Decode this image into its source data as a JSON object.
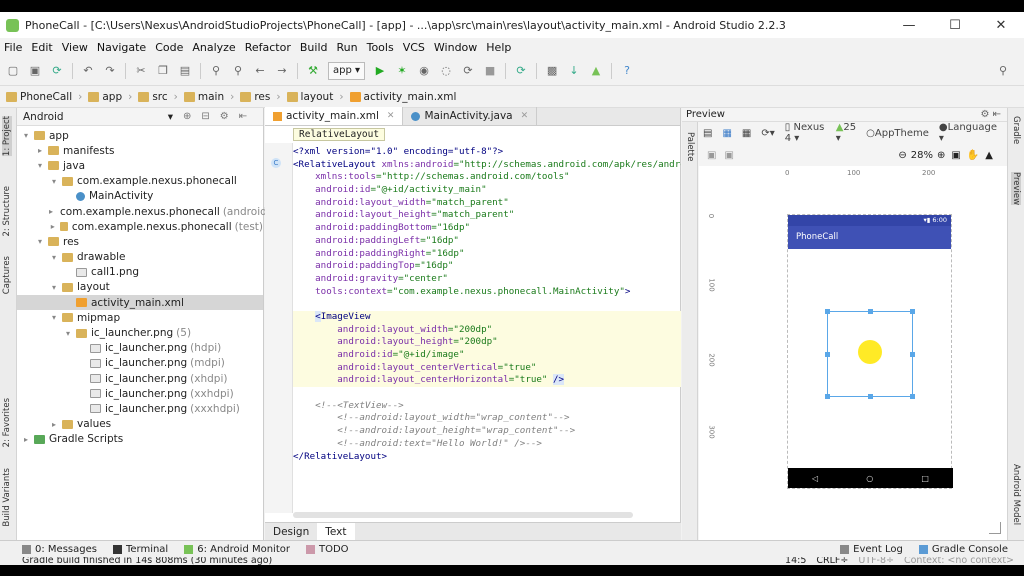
{
  "window": {
    "title": "PhoneCall - [C:\\Users\\Nexus\\AndroidStudioProjects\\PhoneCall] - [app] - ...\\app\\src\\main\\res\\layout\\activity_main.xml - Android Studio 2.2.3",
    "minimize": "—",
    "maximize": "☐",
    "close": "✕"
  },
  "menu": [
    "File",
    "Edit",
    "View",
    "Navigate",
    "Code",
    "Analyze",
    "Refactor",
    "Build",
    "Run",
    "Tools",
    "VCS",
    "Window",
    "Help"
  ],
  "toolbar": {
    "run_config": "app ▾"
  },
  "breadcrumbs": [
    "PhoneCall",
    "app",
    "src",
    "main",
    "res",
    "layout",
    "activity_main.xml"
  ],
  "left_strip": {
    "project": "1: Project",
    "structure": "2: Structure",
    "captures": "Captures",
    "favorites": "2: Favorites",
    "build_variants": "Build Variants"
  },
  "right_strip": {
    "gradle": "Gradle",
    "preview": "Preview",
    "android_model": "Android Model"
  },
  "project": {
    "view_selector": "Android",
    "tree": [
      {
        "label": "app",
        "level": 0,
        "icon": "folder",
        "twisty": "▾"
      },
      {
        "label": "manifests",
        "level": 1,
        "icon": "folder",
        "twisty": "▸"
      },
      {
        "label": "java",
        "level": 1,
        "icon": "folder",
        "twisty": "▾"
      },
      {
        "label": "com.example.nexus.phonecall",
        "level": 2,
        "icon": "folder",
        "twisty": "▾"
      },
      {
        "label": "MainActivity",
        "level": 3,
        "icon": "cls",
        "twisty": ""
      },
      {
        "label": "com.example.nexus.phonecall",
        "suffix": "(androidTest)",
        "level": 2,
        "icon": "folder",
        "twisty": "▸"
      },
      {
        "label": "com.example.nexus.phonecall",
        "suffix": "(test)",
        "level": 2,
        "icon": "folder",
        "twisty": "▸"
      },
      {
        "label": "res",
        "level": 1,
        "icon": "folder",
        "twisty": "▾"
      },
      {
        "label": "drawable",
        "level": 2,
        "icon": "folder",
        "twisty": "▾"
      },
      {
        "label": "call1.png",
        "level": 3,
        "icon": "png",
        "twisty": ""
      },
      {
        "label": "layout",
        "level": 2,
        "icon": "folder",
        "twisty": "▾"
      },
      {
        "label": "activity_main.xml",
        "level": 3,
        "icon": "xml",
        "twisty": "",
        "selected": true
      },
      {
        "label": "mipmap",
        "level": 2,
        "icon": "folder",
        "twisty": "▾"
      },
      {
        "label": "ic_launcher.png",
        "suffix": "(5)",
        "level": 3,
        "icon": "folder",
        "twisty": "▾"
      },
      {
        "label": "ic_launcher.png",
        "suffix": "(hdpi)",
        "level": 4,
        "icon": "png",
        "twisty": ""
      },
      {
        "label": "ic_launcher.png",
        "suffix": "(mdpi)",
        "level": 4,
        "icon": "png",
        "twisty": ""
      },
      {
        "label": "ic_launcher.png",
        "suffix": "(xhdpi)",
        "level": 4,
        "icon": "png",
        "twisty": ""
      },
      {
        "label": "ic_launcher.png",
        "suffix": "(xxhdpi)",
        "level": 4,
        "icon": "png",
        "twisty": ""
      },
      {
        "label": "ic_launcher.png",
        "suffix": "(xxxhdpi)",
        "level": 4,
        "icon": "png",
        "twisty": ""
      },
      {
        "label": "values",
        "level": 2,
        "icon": "folder",
        "twisty": "▸"
      },
      {
        "label": "Gradle Scripts",
        "level": 0,
        "icon": "gradle",
        "twisty": "▸"
      }
    ]
  },
  "editor": {
    "tabs": [
      {
        "label": "activity_main.xml",
        "active": true
      },
      {
        "label": "MainActivity.java",
        "active": false
      }
    ],
    "breadcrumb": "RelativeLayout",
    "lines": [
      [
        {
          "t": "<?xml version=\"1.0\" encoding=\"utf-8\"?>",
          "c": "ctag"
        }
      ],
      [
        {
          "t": "<RelativeLayout ",
          "c": "ctag"
        },
        {
          "t": "xmlns:android",
          "c": "cattr"
        },
        {
          "t": "=\"http://schemas.android.com/apk/res/android\"",
          "c": "cval"
        }
      ],
      [
        {
          "t": "    xmlns:tools",
          "c": "cattr"
        },
        {
          "t": "=\"http://schemas.android.com/tools\"",
          "c": "cval"
        }
      ],
      [
        {
          "t": "    android:id",
          "c": "cattr"
        },
        {
          "t": "=\"@+id/activity_main\"",
          "c": "cval"
        }
      ],
      [
        {
          "t": "    android:layout_width",
          "c": "cattr"
        },
        {
          "t": "=\"match_parent\"",
          "c": "cval"
        }
      ],
      [
        {
          "t": "    android:layout_height",
          "c": "cattr"
        },
        {
          "t": "=\"match_parent\"",
          "c": "cval"
        }
      ],
      [
        {
          "t": "    android:paddingBottom",
          "c": "cattr"
        },
        {
          "t": "=\"16dp\"",
          "c": "cval"
        }
      ],
      [
        {
          "t": "    android:paddingLeft",
          "c": "cattr"
        },
        {
          "t": "=\"16dp\"",
          "c": "cval"
        }
      ],
      [
        {
          "t": "    android:paddingRight",
          "c": "cattr"
        },
        {
          "t": "=\"16dp\"",
          "c": "cval"
        }
      ],
      [
        {
          "t": "    android:paddingTop",
          "c": "cattr"
        },
        {
          "t": "=\"16dp\"",
          "c": "cval"
        }
      ],
      [
        {
          "t": "    android:gravity",
          "c": "cattr"
        },
        {
          "t": "=\"center\"",
          "c": "cval"
        }
      ],
      [
        {
          "t": "    tools:context",
          "c": "cattr"
        },
        {
          "t": "=\"com.example.nexus.phonecall.MainActivity\"",
          "c": "cval"
        },
        {
          "t": ">",
          "c": "ctag"
        }
      ],
      [
        {
          "t": "",
          "c": ""
        }
      ],
      [
        {
          "t": "    ",
          "c": ""
        },
        {
          "t": "<",
          "c": "ctag cbox"
        },
        {
          "t": "ImageView",
          "c": "ctag"
        }
      ],
      [
        {
          "t": "        android:layout_width",
          "c": "cattr"
        },
        {
          "t": "=\"200dp\"",
          "c": "cval"
        }
      ],
      [
        {
          "t": "        android:layout_height",
          "c": "cattr"
        },
        {
          "t": "=\"200dp\"",
          "c": "cval"
        }
      ],
      [
        {
          "t": "        android:id",
          "c": "cattr"
        },
        {
          "t": "=\"@+id/image\"",
          "c": "cval"
        }
      ],
      [
        {
          "t": "        android:layout_centerVertical",
          "c": "cattr"
        },
        {
          "t": "=\"true\"",
          "c": "cval"
        }
      ],
      [
        {
          "t": "        android:layout_centerHorizontal",
          "c": "cattr"
        },
        {
          "t": "=\"true\" ",
          "c": "cval"
        },
        {
          "t": "/>",
          "c": "ctag cbox"
        }
      ],
      [
        {
          "t": "",
          "c": ""
        }
      ],
      [
        {
          "t": "    <!--<TextView-->",
          "c": "ccom"
        }
      ],
      [
        {
          "t": "        <!--android:layout_width=\"wrap_content\"-->",
          "c": "ccom"
        }
      ],
      [
        {
          "t": "        <!--android:layout_height=\"wrap_content\"-->",
          "c": "ccom"
        }
      ],
      [
        {
          "t": "        <!--android:text=\"Hello World!\" />-->",
          "c": "ccom"
        }
      ],
      [
        {
          "t": "</RelativeLayout>",
          "c": "ctag"
        }
      ]
    ],
    "design_tab": "Design",
    "text_tab": "Text"
  },
  "preview": {
    "header": "Preview",
    "palette": "Palette",
    "device": "Nexus 4 ▾",
    "api": "25 ▾",
    "theme": "AppTheme",
    "language": "Language ▾",
    "zoom": "28%",
    "ruler": [
      "0",
      "100",
      "200"
    ],
    "vruler": [
      "0",
      "100",
      "200",
      "300"
    ],
    "status_time": "6:00",
    "app_title": "PhoneCall",
    "nav_back": "◁",
    "nav_home": "○",
    "nav_recent": "□"
  },
  "bottom_tabs": {
    "messages": "0: Messages",
    "terminal": "Terminal",
    "monitor": "6: Android Monitor",
    "todo": "TODO",
    "event_log": "Event Log",
    "gradle_console": "Gradle Console"
  },
  "status": {
    "message": "Gradle build finished in 14s 808ms (30 minutes ago)",
    "position": "14:5",
    "line_sep": "CRLF÷",
    "encoding": "UTF-8÷",
    "context": "Context: <no context>"
  }
}
